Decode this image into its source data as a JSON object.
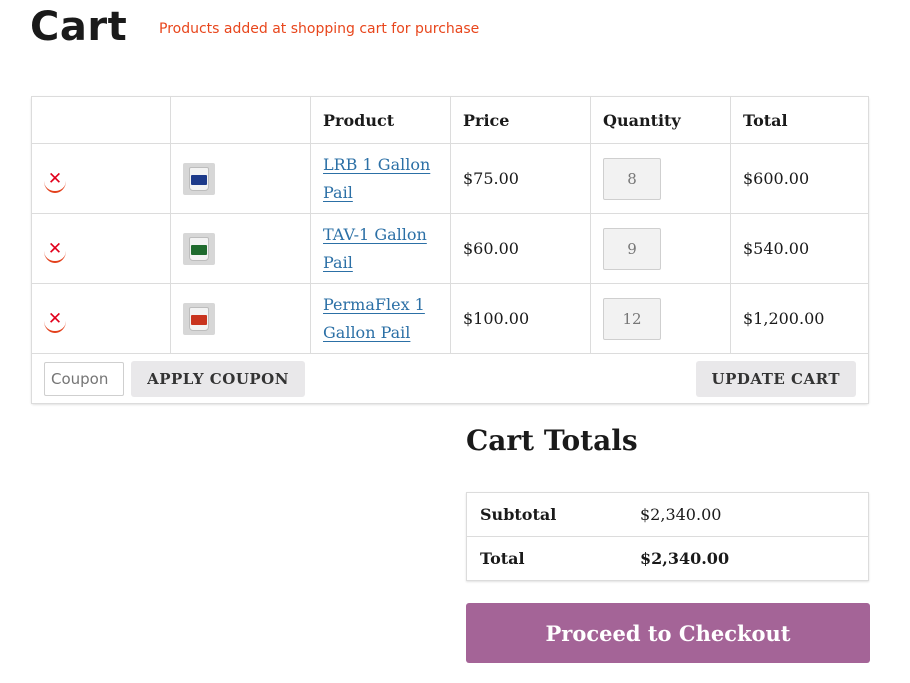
{
  "page": {
    "title": "Cart",
    "subtitle": "Products added at shopping cart for purchase"
  },
  "cart_table": {
    "headers": [
      "",
      "",
      "Product",
      "Price",
      "Quantity",
      "Total"
    ],
    "items": [
      {
        "name": "LRB 1 Gallon Pail",
        "price": "$75.00",
        "quantity": "8",
        "total": "$600.00",
        "thumb_color": "#1d3a8a"
      },
      {
        "name": "TAV-1 Gallon Pail",
        "price": "$60.00",
        "quantity": "9",
        "total": "$540.00",
        "thumb_color": "#1f6b2e"
      },
      {
        "name": "PermaFlex 1 Gallon Pail",
        "price": "$100.00",
        "quantity": "12",
        "total": "$1,200.00",
        "thumb_color": "#c9341e"
      }
    ],
    "remove_icon": "close-icon"
  },
  "coupon": {
    "placeholder": "Coupon",
    "apply_label": "APPLY COUPON"
  },
  "update_cart_label": "UPDATE CART",
  "cart_totals": {
    "title": "Cart Totals",
    "subtotal_label": "Subtotal",
    "subtotal_value": "$2,340.00",
    "total_label": "Total",
    "total_value": "$2,340.00"
  },
  "checkout_label": "Proceed to Checkout",
  "colors": {
    "accent": "#a46497",
    "subtitle": "#e8461c",
    "remove": "#e2001c",
    "link": "#2c70a6"
  }
}
